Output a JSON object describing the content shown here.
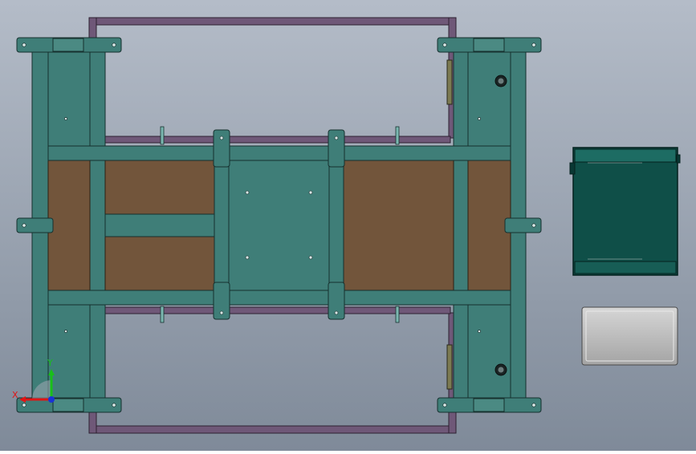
{
  "view": {
    "name": "cad-top-view",
    "colors": {
      "background_top": "#b4bcc8",
      "background_bottom": "#7f8a99",
      "frame_purple": "#6f5878",
      "steel_teal": "#3f7e78",
      "steel_teal_dark": "#2f625d",
      "steel_edge": "#16302e",
      "wood_brown": "#72553b",
      "cabinet_dark": "#0f4f48",
      "box_gray": "#b6b6b6",
      "axis_red": "#e01515",
      "axis_green": "#18c018",
      "axis_blue": "#1a33d6"
    }
  },
  "triad": {
    "x_label": "X",
    "y_label": "Y",
    "icons": [
      "axis-triad-icon"
    ]
  }
}
